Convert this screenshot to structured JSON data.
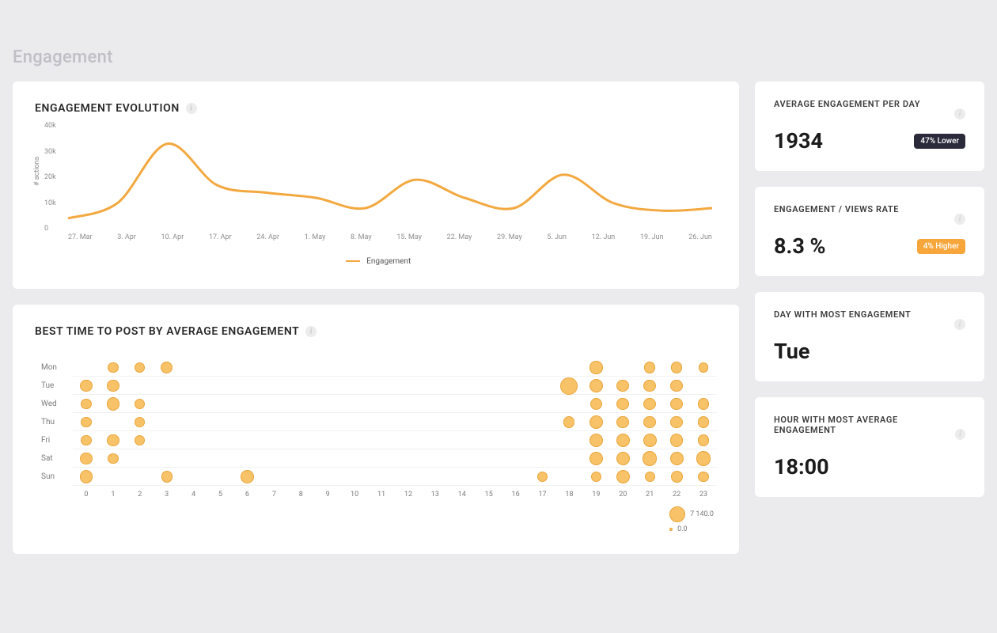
{
  "page": {
    "title": "Engagement"
  },
  "accent": "#f3a83f",
  "cards": {
    "evolution": {
      "title": "ENGAGEMENT EVOLUTION",
      "legend_label": "Engagement"
    },
    "best_time": {
      "title": "BEST TIME TO POST BY AVERAGE ENGAGEMENT"
    }
  },
  "stats": {
    "avg_per_day": {
      "title": "AVERAGE ENGAGEMENT PER DAY",
      "value": "1934",
      "badge": "47% Lower",
      "badge_style": "dark"
    },
    "views_rate": {
      "title": "ENGAGEMENT / VIEWS RATE",
      "value": "8.3 %",
      "badge": "4% Higher",
      "badge_style": "orange"
    },
    "best_day": {
      "title": "DAY WITH MOST ENGAGEMENT",
      "value": "Tue"
    },
    "best_hour": {
      "title": "HOUR WITH MOST AVERAGE ENGAGEMENT",
      "value": "18:00"
    }
  },
  "chart_data": [
    {
      "id": "engagement_evolution",
      "type": "line",
      "title": "ENGAGEMENT EVOLUTION",
      "ylabel": "# actions",
      "ylim": [
        0,
        40000
      ],
      "y_ticks": [
        "0",
        "10k",
        "20k",
        "30k",
        "40k"
      ],
      "x_ticks": [
        "27. Mar",
        "3. Apr",
        "10. Apr",
        "17. Apr",
        "24. Apr",
        "1. May",
        "8. May",
        "15. May",
        "22. May",
        "29. May",
        "5. Jun",
        "12. Jun",
        "19. Jun",
        "26. Jun"
      ],
      "series": [
        {
          "name": "Engagement",
          "color": "#f3a83f",
          "x": [
            "27. Mar",
            "3. Apr",
            "10. Apr",
            "17. Apr",
            "24. Apr",
            "1. May",
            "8. May",
            "15. May",
            "22. May",
            "29. May",
            "5. Jun",
            "12. Jun",
            "19. Jun",
            "26. Jun"
          ],
          "y": [
            4000,
            10000,
            33000,
            17000,
            14000,
            12000,
            8000,
            19000,
            12000,
            8000,
            21000,
            10000,
            7000,
            8000
          ]
        }
      ]
    },
    {
      "id": "best_time_bubble",
      "type": "bubble-heatmap",
      "title": "BEST TIME TO POST BY AVERAGE ENGAGEMENT",
      "y_categories": [
        "Mon",
        "Tue",
        "Wed",
        "Thu",
        "Fri",
        "Sat",
        "Sun"
      ],
      "x_categories": [
        "0",
        "1",
        "2",
        "3",
        "4",
        "5",
        "6",
        "7",
        "8",
        "9",
        "10",
        "11",
        "12",
        "13",
        "14",
        "15",
        "16",
        "17",
        "18",
        "19",
        "20",
        "21",
        "22",
        "23"
      ],
      "size_legend": {
        "max_label": "7 140.0",
        "min_label": "0.0"
      },
      "data": [
        {
          "day": "Mon",
          "hour": 1,
          "value": 1500
        },
        {
          "day": "Mon",
          "hour": 2,
          "value": 1500
        },
        {
          "day": "Mon",
          "hour": 3,
          "value": 2500
        },
        {
          "day": "Mon",
          "hour": 19,
          "value": 3000
        },
        {
          "day": "Mon",
          "hour": 21,
          "value": 1800
        },
        {
          "day": "Mon",
          "hour": 22,
          "value": 1800
        },
        {
          "day": "Mon",
          "hour": 23,
          "value": 1200
        },
        {
          "day": "Tue",
          "hour": 0,
          "value": 2400
        },
        {
          "day": "Tue",
          "hour": 1,
          "value": 2400
        },
        {
          "day": "Tue",
          "hour": 18,
          "value": 7140
        },
        {
          "day": "Tue",
          "hour": 19,
          "value": 3400
        },
        {
          "day": "Tue",
          "hour": 20,
          "value": 2600
        },
        {
          "day": "Tue",
          "hour": 21,
          "value": 2600
        },
        {
          "day": "Tue",
          "hour": 22,
          "value": 2600
        },
        {
          "day": "Wed",
          "hour": 0,
          "value": 1500
        },
        {
          "day": "Wed",
          "hour": 1,
          "value": 3200
        },
        {
          "day": "Wed",
          "hour": 2,
          "value": 1500
        },
        {
          "day": "Wed",
          "hour": 19,
          "value": 2600
        },
        {
          "day": "Wed",
          "hour": 20,
          "value": 2600
        },
        {
          "day": "Wed",
          "hour": 21,
          "value": 2600
        },
        {
          "day": "Wed",
          "hour": 22,
          "value": 2600
        },
        {
          "day": "Wed",
          "hour": 23,
          "value": 1800
        },
        {
          "day": "Thu",
          "hour": 0,
          "value": 1500
        },
        {
          "day": "Thu",
          "hour": 2,
          "value": 1500
        },
        {
          "day": "Thu",
          "hour": 18,
          "value": 1800
        },
        {
          "day": "Thu",
          "hour": 19,
          "value": 3400
        },
        {
          "day": "Thu",
          "hour": 20,
          "value": 2600
        },
        {
          "day": "Thu",
          "hour": 21,
          "value": 2600
        },
        {
          "day": "Thu",
          "hour": 22,
          "value": 2600
        },
        {
          "day": "Thu",
          "hour": 23,
          "value": 1800
        },
        {
          "day": "Fri",
          "hour": 0,
          "value": 1500
        },
        {
          "day": "Fri",
          "hour": 1,
          "value": 2600
        },
        {
          "day": "Fri",
          "hour": 2,
          "value": 1500
        },
        {
          "day": "Fri",
          "hour": 19,
          "value": 3800
        },
        {
          "day": "Fri",
          "hour": 20,
          "value": 3400
        },
        {
          "day": "Fri",
          "hour": 21,
          "value": 3400
        },
        {
          "day": "Fri",
          "hour": 22,
          "value": 2800
        },
        {
          "day": "Fri",
          "hour": 23,
          "value": 1800
        },
        {
          "day": "Sat",
          "hour": 0,
          "value": 2600
        },
        {
          "day": "Sat",
          "hour": 1,
          "value": 1500
        },
        {
          "day": "Sat",
          "hour": 19,
          "value": 3400
        },
        {
          "day": "Sat",
          "hour": 20,
          "value": 3400
        },
        {
          "day": "Sat",
          "hour": 21,
          "value": 4200
        },
        {
          "day": "Sat",
          "hour": 22,
          "value": 3400
        },
        {
          "day": "Sat",
          "hour": 23,
          "value": 4200
        },
        {
          "day": "Sun",
          "hour": 0,
          "value": 3200
        },
        {
          "day": "Sun",
          "hour": 3,
          "value": 1800
        },
        {
          "day": "Sun",
          "hour": 6,
          "value": 3200
        },
        {
          "day": "Sun",
          "hour": 17,
          "value": 1500
        },
        {
          "day": "Sun",
          "hour": 19,
          "value": 1500
        },
        {
          "day": "Sun",
          "hour": 20,
          "value": 3400
        },
        {
          "day": "Sun",
          "hour": 21,
          "value": 1500
        },
        {
          "day": "Sun",
          "hour": 22,
          "value": 2200
        },
        {
          "day": "Sun",
          "hour": 23,
          "value": 1500
        }
      ]
    }
  ]
}
